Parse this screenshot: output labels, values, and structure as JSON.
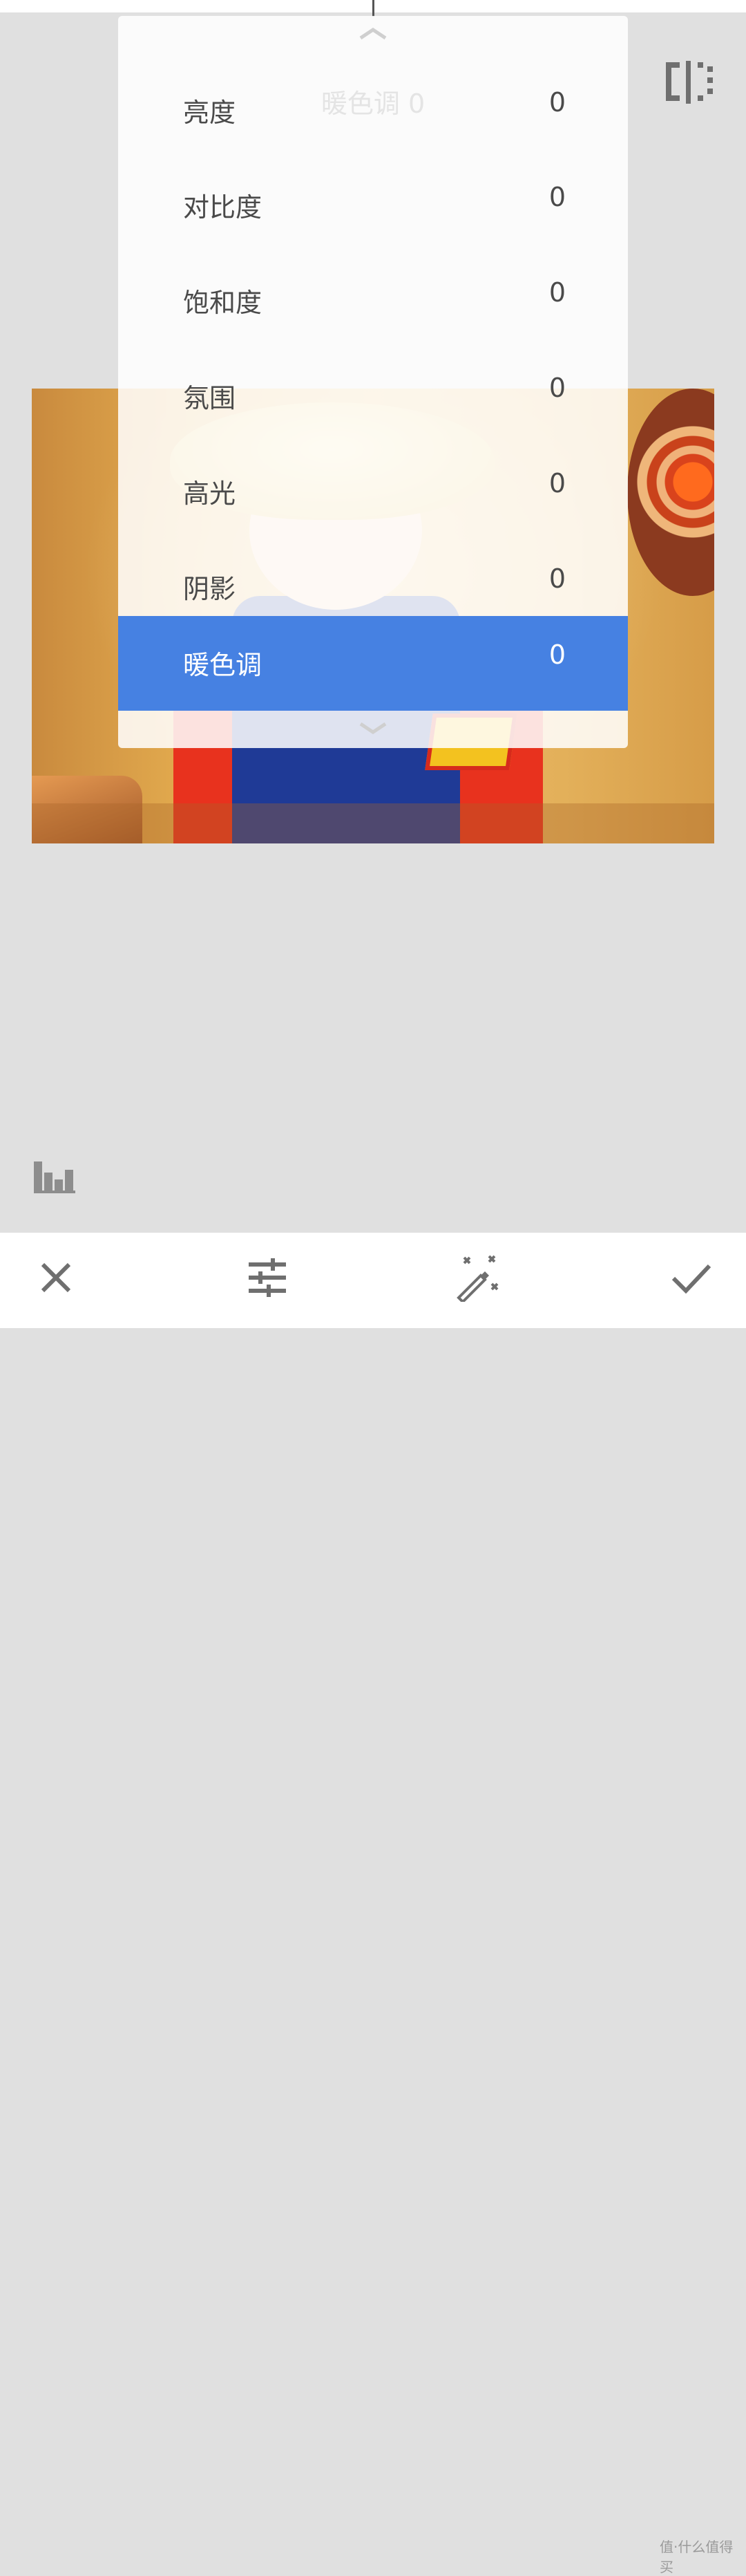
{
  "overlay": {
    "current_adjustment": "暖色调 0"
  },
  "adjustments": {
    "items": [
      {
        "label": "亮度",
        "value": "0"
      },
      {
        "label": "对比度",
        "value": "0"
      },
      {
        "label": "饱和度",
        "value": "0"
      },
      {
        "label": "氛围",
        "value": "0"
      },
      {
        "label": "高光",
        "value": "0"
      },
      {
        "label": "阴影",
        "value": "0"
      },
      {
        "label": "暖色调",
        "value": "0",
        "selected": true
      }
    ]
  },
  "icons": {
    "compare": "compare-icon",
    "histogram": "histogram-icon",
    "cancel": "close-icon",
    "tune": "sliders-icon",
    "auto": "magic-wand-icon",
    "apply": "checkmark-icon",
    "scroll_up": "chevron-up-icon",
    "scroll_down": "chevron-down-icon"
  },
  "colors": {
    "selected_row": "#4681e2",
    "background": "#e0e0e0",
    "icon": "#6f6f6f"
  },
  "watermark": "值·什么值得买"
}
